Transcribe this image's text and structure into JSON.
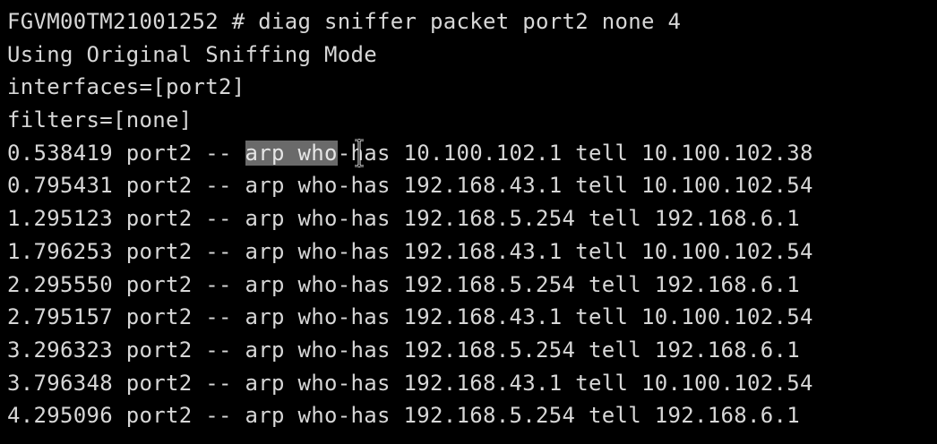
{
  "terminal": {
    "command_line": {
      "prompt": "FGVM00TM21001252 # ",
      "command": "diag sniffer packet port2 none 4"
    },
    "info_lines": [
      "Using Original Sniffing Mode",
      "interfaces=[port2]",
      "filters=[none]"
    ],
    "packets": [
      {
        "time": "0.538419",
        "rest": " port2 -- ",
        "sel": "arp who",
        "tail": "-has 10.100.102.1 tell 10.100.102.38"
      },
      {
        "time": "0.795431",
        "rest": " port2 -- arp who-has 192.168.43.1 tell 10.100.102.54"
      },
      {
        "time": "1.295123",
        "rest": " port2 -- arp who-has 192.168.5.254 tell 192.168.6.1"
      },
      {
        "time": "1.796253",
        "rest": " port2 -- arp who-has 192.168.43.1 tell 10.100.102.54"
      },
      {
        "time": "2.295550",
        "rest": " port2 -- arp who-has 192.168.5.254 tell 192.168.6.1"
      },
      {
        "time": "2.795157",
        "rest": " port2 -- arp who-has 192.168.43.1 tell 10.100.102.54"
      },
      {
        "time": "3.296323",
        "rest": " port2 -- arp who-has 192.168.5.254 tell 192.168.6.1"
      },
      {
        "time": "3.796348",
        "rest": " port2 -- arp who-has 192.168.43.1 tell 10.100.102.54"
      },
      {
        "time": "4.295096",
        "rest": " port2 -- arp who-has 192.168.5.254 tell 192.168.6.1"
      }
    ],
    "cursor_icon": "text-cursor-icon",
    "colors": {
      "background": "#000000",
      "text": "#d7d7d7",
      "selection": "#6a6a6a"
    }
  }
}
